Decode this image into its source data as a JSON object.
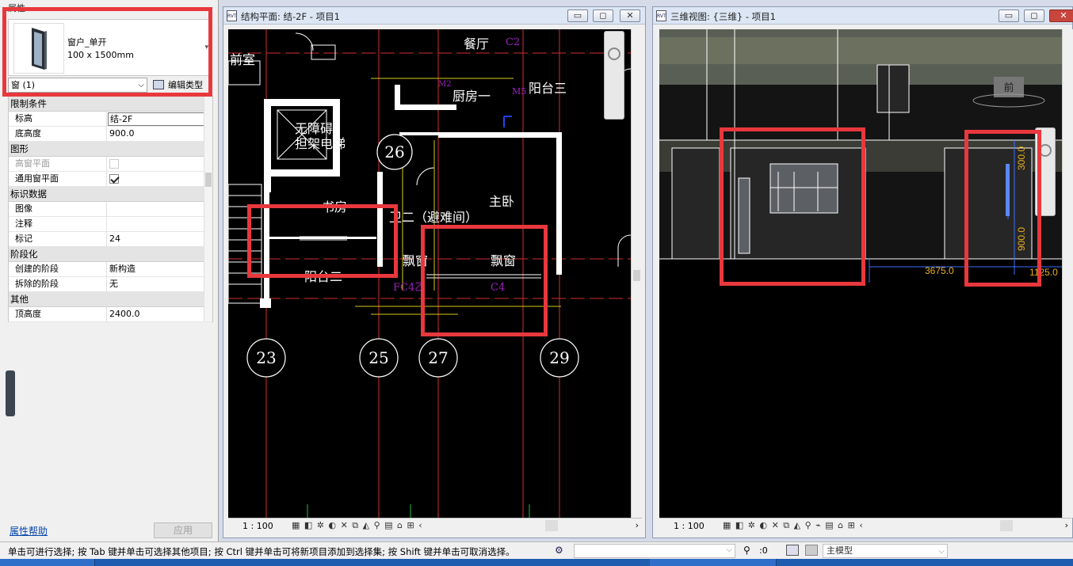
{
  "properties": {
    "panel_title": "属性",
    "type_name": "窗户_单开",
    "type_size": "100 x 1500mm",
    "selector": "窗 (1)",
    "edit_type": "编辑类型",
    "sections": [
      {
        "title": "限制条件",
        "rows": [
          {
            "key": "标高",
            "value": "结-2F"
          },
          {
            "key": "底高度",
            "value": "900.0"
          }
        ]
      },
      {
        "title": "图形",
        "rows": [
          {
            "key": "高窗平面",
            "value": ""
          },
          {
            "key": "通用窗平面",
            "value": ""
          }
        ]
      },
      {
        "title": "标识数据",
        "rows": [
          {
            "key": "图像",
            "value": ""
          },
          {
            "key": "注释",
            "value": ""
          },
          {
            "key": "标记",
            "value": "24"
          }
        ]
      },
      {
        "title": "阶段化",
        "rows": [
          {
            "key": "创建的阶段",
            "value": "新构造"
          },
          {
            "key": "拆除的阶段",
            "value": "无"
          }
        ]
      },
      {
        "title": "其他",
        "rows": [
          {
            "key": "顶高度",
            "value": "2400.0"
          }
        ]
      }
    ],
    "help_link": "属性帮助",
    "apply_button": "应用"
  },
  "plan_view": {
    "title": "结构平面: 结-2F - 项目1",
    "scale": "1 : 100",
    "grid_bubbles": [
      "23",
      "25",
      "27",
      "29",
      "26"
    ],
    "room_labels": [
      "餐厅",
      "厨房一",
      "阳台三",
      "主卧",
      "书房",
      "卫二（避难间）",
      "飘窗",
      "飘窗",
      "阳台二",
      "无障碍",
      "担架电梯",
      "前室"
    ],
    "tags": [
      "C2",
      "M5",
      "C4",
      "FC4乙",
      "M2"
    ]
  },
  "view3d": {
    "title": "三维视图: {三维} - 项目1",
    "scale": "1 : 100",
    "dims": [
      "3675.0",
      "1125.0",
      "900.0",
      "300.0"
    ],
    "nav_label": "前"
  },
  "status": {
    "hint": "单击可进行选择; 按 Tab 键并单击可选择其他项目; 按 Ctrl 键并单击可将新项目添加到选择集; 按 Shift 键并单击可取消选择。",
    "selection_count": ":0",
    "model": "主模型"
  }
}
